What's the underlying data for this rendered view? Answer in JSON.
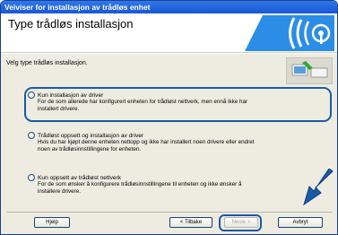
{
  "window": {
    "title": "Veiviser for installasjon av trådløs enhet"
  },
  "header": {
    "heading": "Type trådløs installasjon"
  },
  "main": {
    "instruction": "Velg type trådløs installasjon.",
    "options": [
      {
        "label": "Kun installasjon av driver",
        "desc": [
          "For de som allerede har konfigurert enheten for trådløst nettverk, men ennå ikke har",
          "installert drivere."
        ],
        "selected": false
      },
      {
        "label": "Trådløst oppsett og installasjon av driver",
        "desc": [
          "Hvis du har kjøpt denne enheten nettopp og ikke har installert noen drivere eller endret",
          "noen av trådløsinnstillingene for enheten."
        ],
        "selected": false
      },
      {
        "label": "Kun oppsett av trådløst nettverk",
        "desc": [
          "For de som ønsker å konfigurere trådløsinnstillingene til enheten og ikke ønsker å",
          "installere drivere."
        ],
        "selected": false
      }
    ]
  },
  "footer": {
    "help": "Hjelp",
    "back": "< Tilbake",
    "next": "Neste >",
    "cancel": "Avbryt"
  },
  "icons": {
    "logo": "wireless-logo-icon",
    "illustration": "computer-printer-illustration",
    "arrow": "pointer-arrow-icon"
  },
  "colors": {
    "title_bar": "#1a57d4",
    "highlight": "#1a5aa8",
    "body_bg": "#eeece1"
  }
}
